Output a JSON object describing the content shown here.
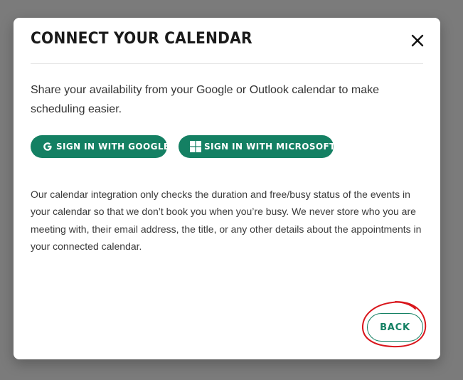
{
  "dialog": {
    "title": "CONNECT YOUR CALENDAR",
    "close_icon": "close-icon",
    "intro_text": "Share your availability from your Google or Outlook calendar to make scheduling easier.",
    "buttons": {
      "google": {
        "label": "SIGN IN WITH GOOGLE",
        "icon": "google-icon"
      },
      "microsoft": {
        "label": "SIGN IN WITH MICROSOFT",
        "icon": "windows-icon"
      }
    },
    "info_text": "Our calendar integration only checks the duration and free/busy status of the events in your calendar so that we don’t book you when you’re busy. We never store who you are meeting with, their email address, the title, or any other details about the appointments in your connected calendar.",
    "back_label": "BACK"
  },
  "colors": {
    "backdrop": "#7b7b7b",
    "accent": "#148063",
    "annotation": "#d9161c"
  }
}
